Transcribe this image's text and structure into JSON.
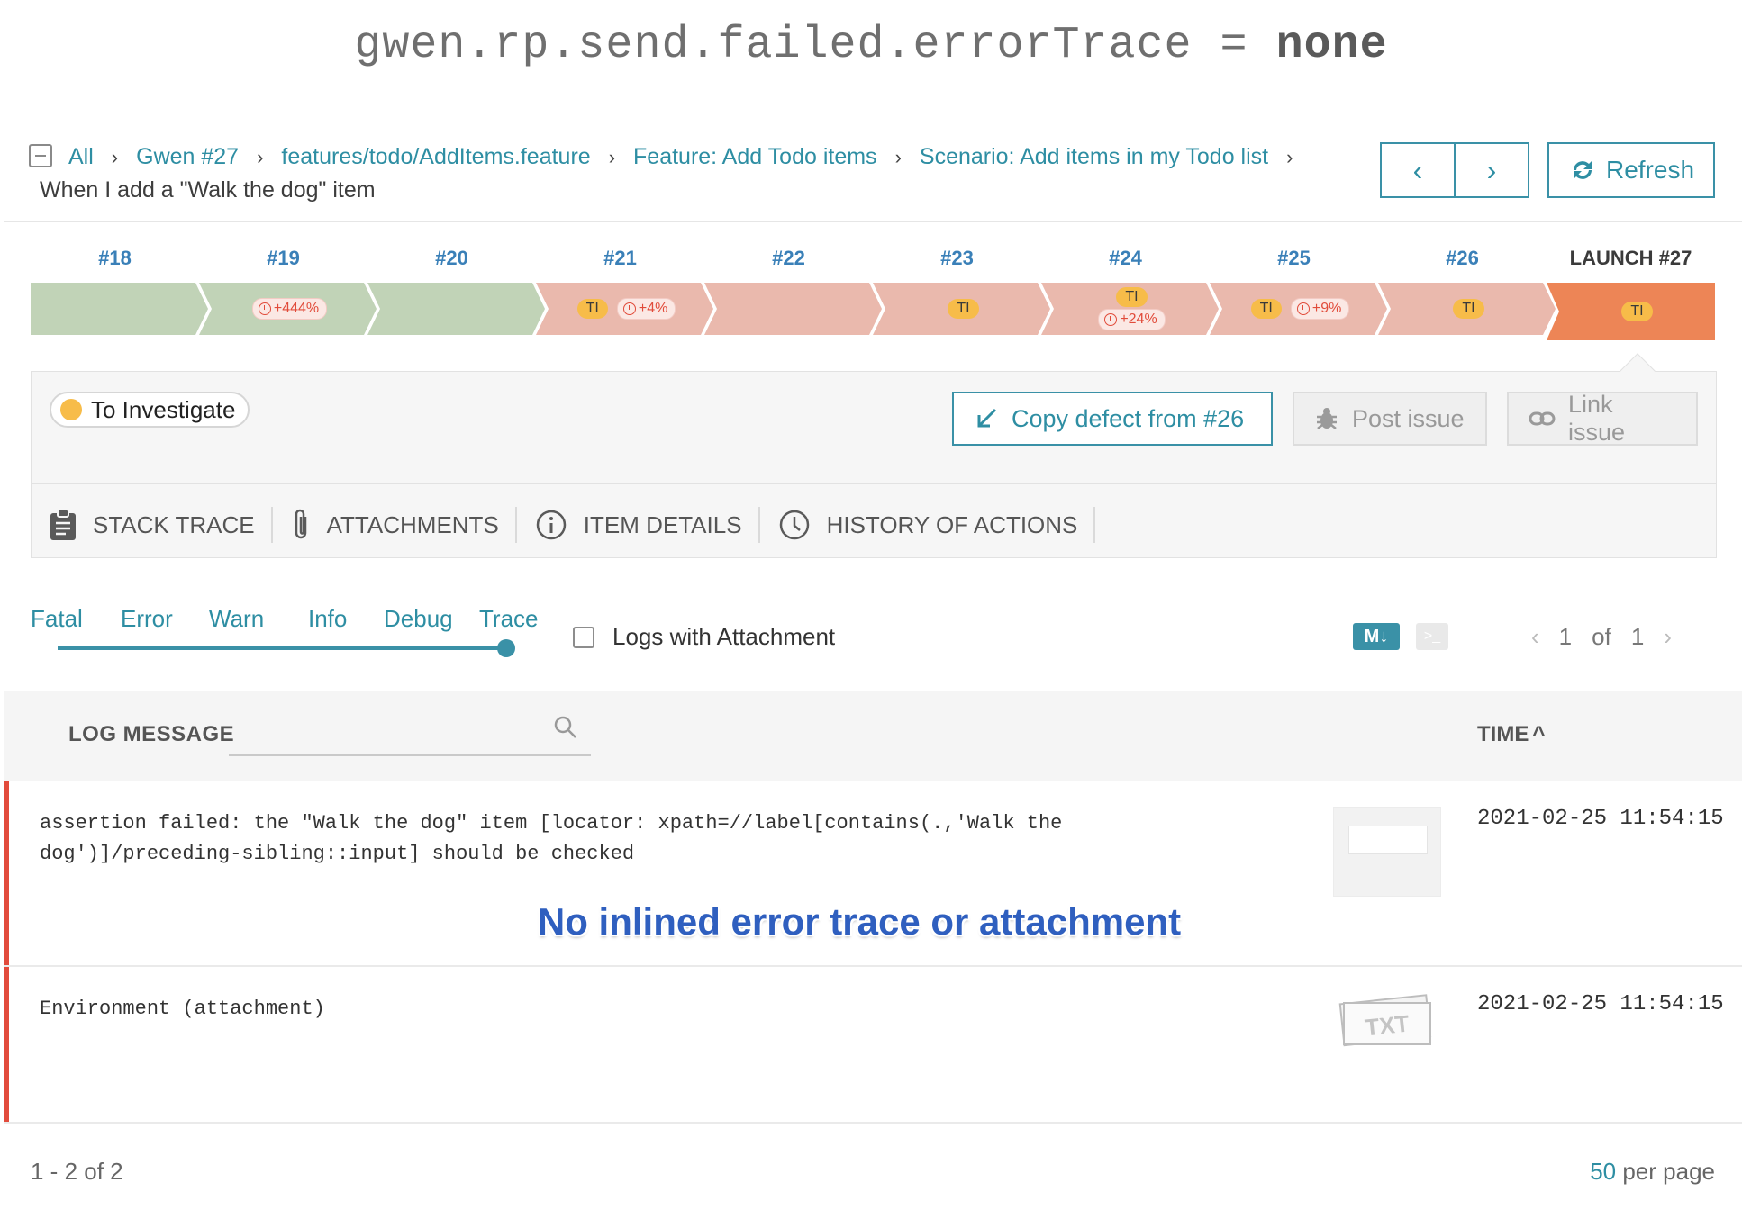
{
  "caption": {
    "prefix": "gwen.rp.send.failed.errorTrace = ",
    "value": "none"
  },
  "breadcrumbs": {
    "items": [
      "All",
      "Gwen #27",
      "features/todo/AddItems.feature",
      "Feature: Add Todo items",
      "Scenario: Add items in my Todo list"
    ],
    "current": "When I add a \"Walk the dog\" item"
  },
  "toolbar": {
    "prev_icon": "‹",
    "next_icon": "›",
    "refresh_label": "Refresh"
  },
  "history": [
    {
      "label": "#18",
      "status": "passed",
      "ti": false,
      "duration": ""
    },
    {
      "label": "#19",
      "status": "passed",
      "ti": false,
      "duration": "+444%"
    },
    {
      "label": "#20",
      "status": "passed",
      "ti": false,
      "duration": ""
    },
    {
      "label": "#21",
      "status": "failed",
      "ti": true,
      "duration": "+4%"
    },
    {
      "label": "#22",
      "status": "failed",
      "ti": false,
      "duration": ""
    },
    {
      "label": "#23",
      "status": "failed",
      "ti": true,
      "duration": ""
    },
    {
      "label": "#24",
      "status": "failed",
      "ti": true,
      "duration": "+24%",
      "stacked": true
    },
    {
      "label": "#25",
      "status": "failed",
      "ti": true,
      "duration": "+9%"
    },
    {
      "label": "#26",
      "status": "failed",
      "ti": true,
      "duration": ""
    },
    {
      "label": "LAUNCH #27",
      "status": "current",
      "ti": true,
      "duration": ""
    }
  ],
  "ti_label": "TI",
  "colors": {
    "passed": "#c1d3b7",
    "failed": "#eab9ad",
    "current": "#ed8556",
    "accent": "#3a91a7",
    "ti": "#f7bc49",
    "fail_bar": "#e24b3c"
  },
  "defect": {
    "status": "To Investigate",
    "copy_label": "Copy defect from #26",
    "post_label": "Post issue",
    "link_label": "Link issue"
  },
  "tabs": [
    {
      "label": "STACK TRACE",
      "icon": "clipboard-icon"
    },
    {
      "label": "ATTACHMENTS",
      "icon": "paperclip-icon"
    },
    {
      "label": "ITEM DETAILS",
      "icon": "info-icon"
    },
    {
      "label": "HISTORY OF ACTIONS",
      "icon": "clock-icon"
    }
  ],
  "log_levels": [
    "Fatal",
    "Error",
    "Warn",
    "Info",
    "Debug",
    "Trace"
  ],
  "selected_level": "Trace",
  "logs_with_attachment": "Logs with Attachment",
  "markdown_label": "M↓",
  "console_label": ">_",
  "pagination": {
    "page": "1",
    "of": "of",
    "total": "1"
  },
  "table": {
    "col_message": "LOG MESSAGE",
    "col_time": "TIME",
    "sort_icon": "^",
    "rows": [
      {
        "message": "assertion failed: the \"Walk the dog\" item [locator: xpath=//label[contains(.,'Walk the dog')]/preceding-sibling::input] should be checked",
        "time": "2021-02-25 11:54:15",
        "attachment": "screenshot"
      },
      {
        "message": "Environment (attachment)",
        "time": "2021-02-25 11:54:15",
        "attachment": "txt",
        "attachment_label": "TXT"
      }
    ]
  },
  "annotation": "No inlined error trace or attachment",
  "footer": {
    "count": "1 - 2 of 2",
    "per_page_value": "50",
    "per_page_label": " per page"
  }
}
